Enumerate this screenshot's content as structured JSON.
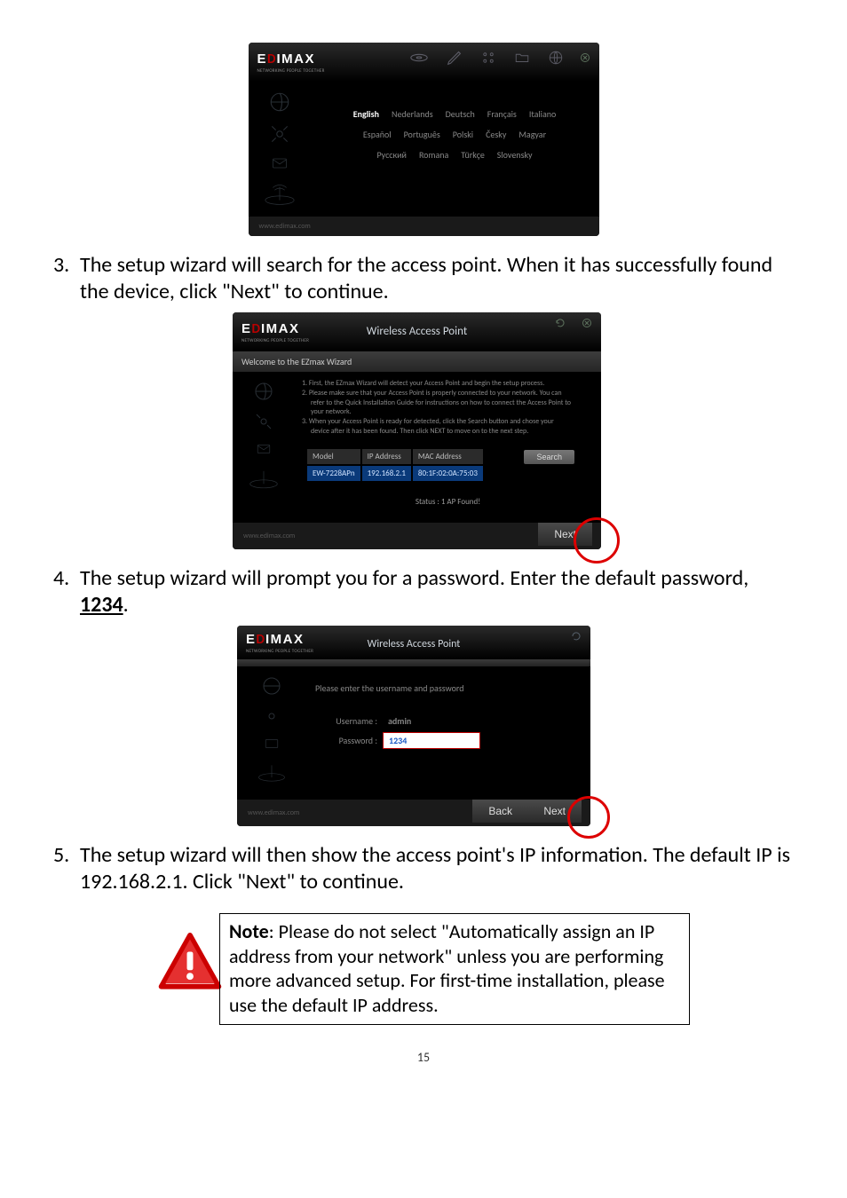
{
  "card1": {
    "brand_sub": "NETWORKING PEOPLE TOGETHER",
    "langs_r1": [
      "English",
      "Nederlands",
      "Deutsch",
      "Français",
      "Italiano"
    ],
    "langs_r2": [
      "Español",
      "Português",
      "Polski",
      "Česky",
      "Magyar"
    ],
    "langs_r3": [
      "Русский",
      "Romana",
      "Türkçe",
      "Slovensky"
    ],
    "footer": "www.edimax.com"
  },
  "step3": {
    "num": "3.",
    "text": "The setup wizard will search for the access point. When it has successfully found the device, click \"Next\" to continue."
  },
  "card2": {
    "title": "Wireless Access Point",
    "welcome": "Welcome to the EZmax Wizard",
    "s1": "1. First, the EZmax Wizard will detect your Access Point and begin the setup process.",
    "s2a": "2. Please make sure that your Access Point is properly connected to your network. You can",
    "s2b": "refer to the Quick Installation Guide for instructions on how to connect the Access Point to",
    "s2c": "your network.",
    "s3a": "3. When your Access Point is ready for detected, click the Search button and chose your",
    "s3b": "device after it has been found. Then click NEXT to move on to the next step.",
    "th1": "Model",
    "th2": "IP Address",
    "th3": "MAC Address",
    "td1": "EW-7228APn",
    "td2": "192.168.2.1",
    "td3": "80:1F:02:0A:75:03",
    "search": "Search",
    "status": "Status : 1 AP Found!",
    "next": "Next",
    "footer": "www.edimax.com"
  },
  "step4": {
    "num": "4.",
    "text_a": "The setup wizard will prompt you for a password. Enter the default password, ",
    "text_pw": "1234",
    "text_b": "."
  },
  "card3": {
    "title": "Wireless Access Point",
    "prompt": "Please enter the username and password",
    "user_lab": "Username :",
    "user_val": "admin",
    "pass_lab": "Password :",
    "pass_val": "1234",
    "back": "Back",
    "next": "Next",
    "footer": "www.edimax.com"
  },
  "step5": {
    "num": "5.",
    "text": "The setup wizard will then show the access point's IP information. The default IP is 192.168.2.1. Click \"Next\" to continue."
  },
  "note": {
    "label": "Note",
    "text": ": Please do not select \"Automatically assign an IP address from your network\" unless you are performing more advanced setup. For first-time installation, please use the default IP address."
  },
  "pagenum": "15"
}
